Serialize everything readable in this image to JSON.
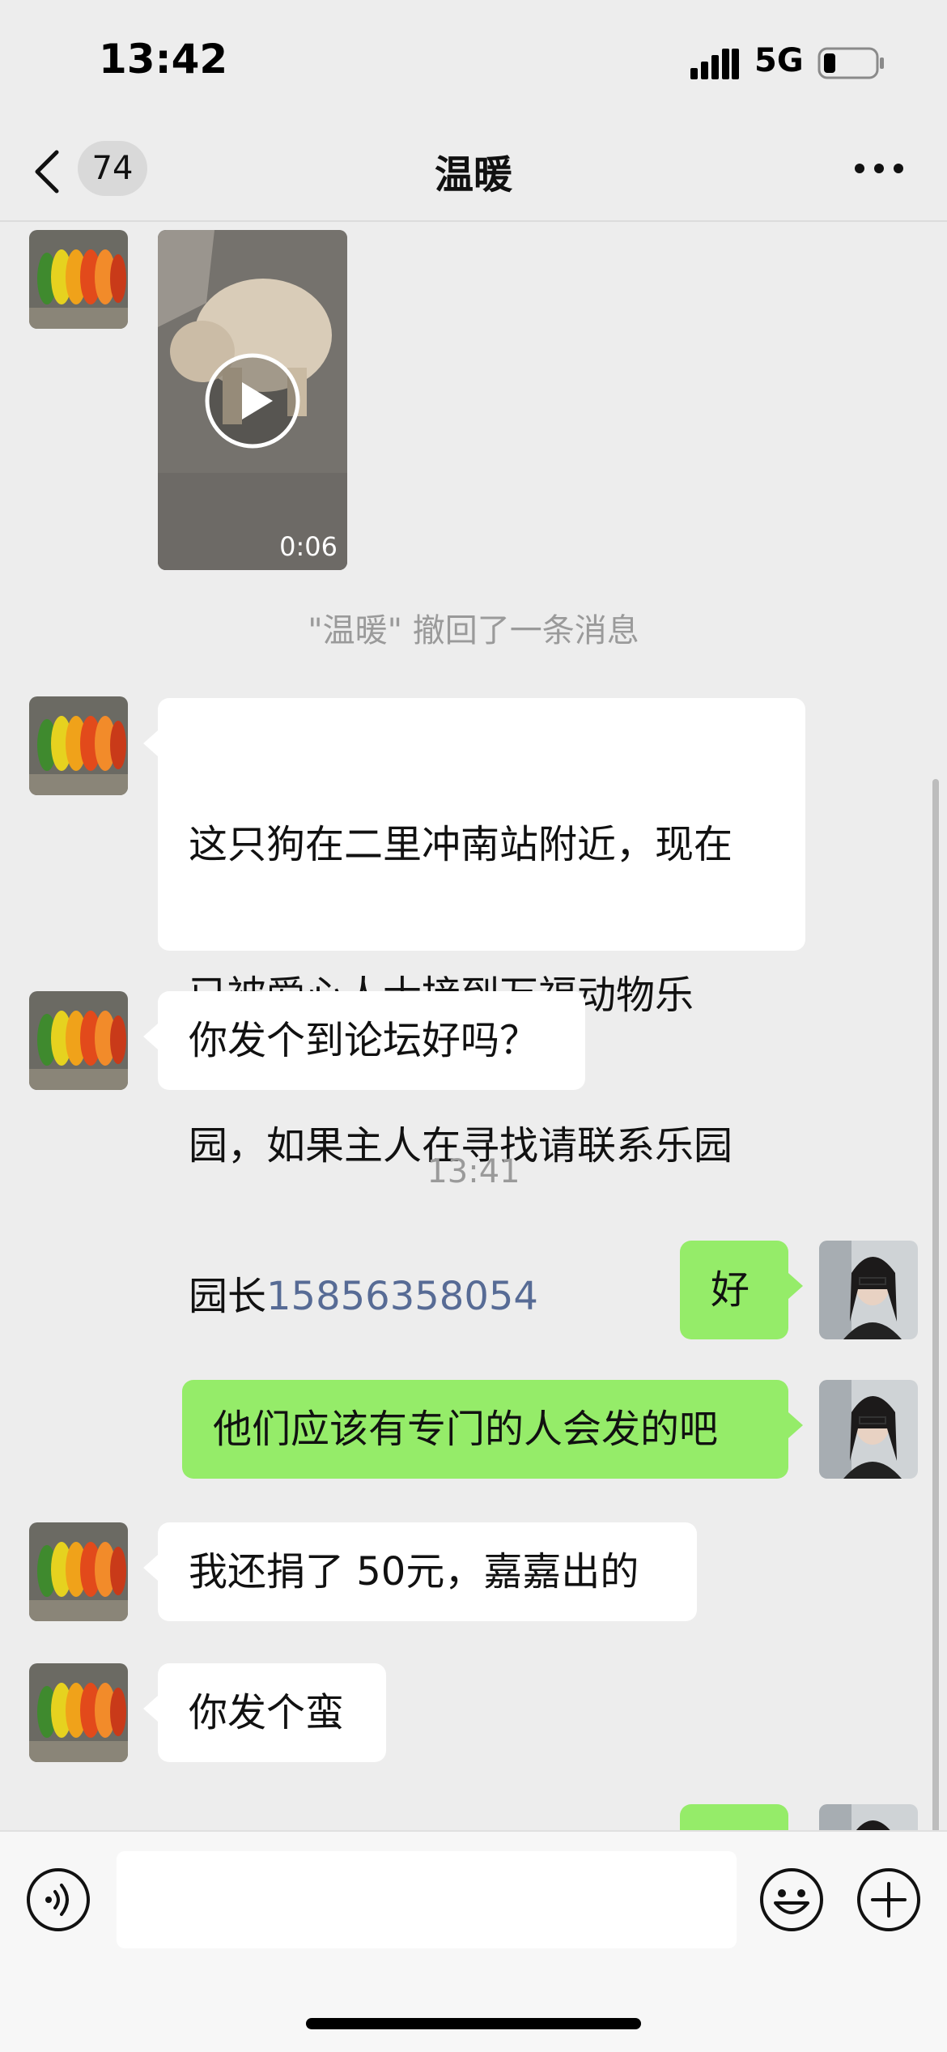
{
  "status_bar": {
    "time": "13:42",
    "network": "5G"
  },
  "nav": {
    "unread_count": "74",
    "title": "温暖"
  },
  "messages": [
    {
      "type": "video",
      "from": "other",
      "duration": "0:06"
    },
    {
      "type": "recall_notice",
      "text": "\"温暖\" 撤回了一条消息"
    },
    {
      "type": "text",
      "from": "other",
      "lines": [
        "这只狗在二里冲南站附近，现在",
        "已被爱心人士接到万福动物乐",
        "园，如果主人在寻找请联系乐园",
        "园长"
      ],
      "phone": "15856358054"
    },
    {
      "type": "text",
      "from": "other",
      "text": "你发个到论坛好吗？"
    },
    {
      "type": "timestamp",
      "text": "13:41"
    },
    {
      "type": "text",
      "from": "me",
      "text": "好"
    },
    {
      "type": "text",
      "from": "me",
      "text": "他们应该有专门的人会发的吧"
    },
    {
      "type": "text",
      "from": "other",
      "text": "我还捐了 50元，嘉嘉出的"
    },
    {
      "type": "text",
      "from": "other",
      "text": "你发个蛮"
    }
  ],
  "colors": {
    "incoming_bubble": "#ffffff",
    "outgoing_bubble": "#95ec69",
    "background": "#ededed",
    "link": "#576b95"
  }
}
